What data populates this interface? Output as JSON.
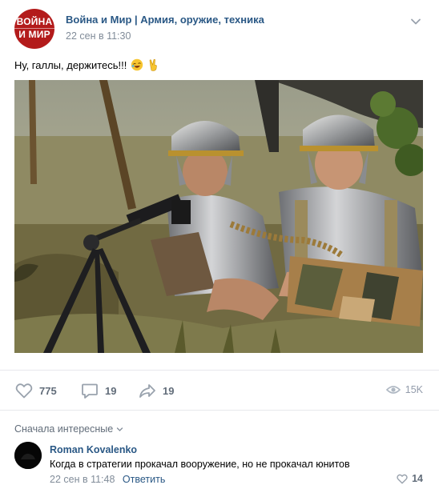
{
  "post": {
    "group_name": "Война и Мир | Армия, оружие, техника",
    "time": "22 сен в 11:30",
    "avatar_text": [
      "ВОЙНА",
      "И МИР"
    ],
    "text": "Ну, галлы, держитесь!!!",
    "emojis": [
      "rolling-laughing-emoji",
      "victory-hand-emoji"
    ],
    "photo_alt_icon": "photo"
  },
  "actions": {
    "likes": "775",
    "comments": "19",
    "shares": "19",
    "views": "15K"
  },
  "comments_section": {
    "sort_label": "Сначала интересные"
  },
  "comment": {
    "author": "Roman Kovalenko",
    "text": "Когда в стратегии прокачал вооружение, но не прокачал юнитов",
    "time": "22 сен в 11:48",
    "reply_label": "Ответить",
    "likes": "14"
  },
  "colors": {
    "link": "#2a5885",
    "muted": "#818c99",
    "icon": "#99a2ad",
    "avatar_red": "#b31b1b"
  }
}
